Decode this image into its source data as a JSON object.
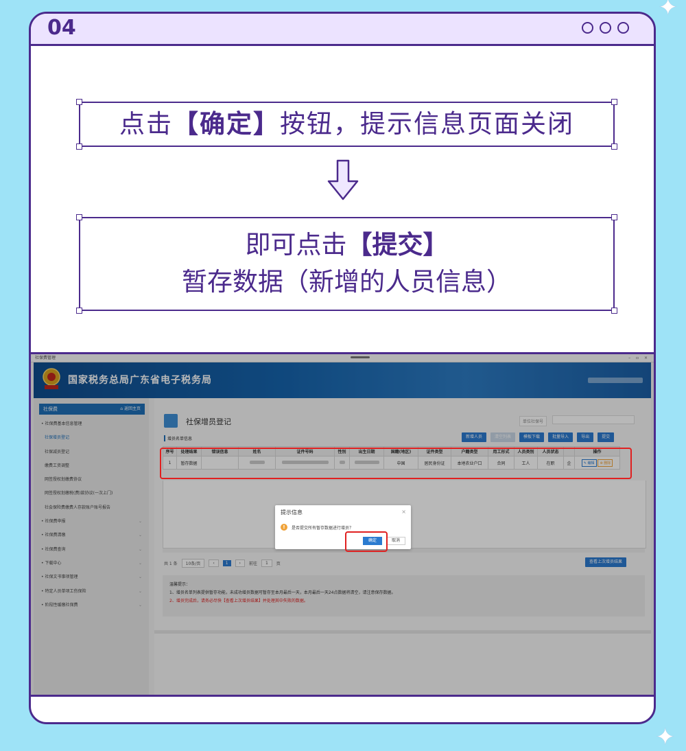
{
  "step": {
    "number": "04"
  },
  "instruction1": {
    "prefix": "点击",
    "highlight": "【确定】",
    "suffix": "按钮，提示信息页面关闭"
  },
  "instruction2": {
    "prefix": "即可点击",
    "highlight": "【提交】",
    "line2": "暂存数据（新增的人员信息）"
  },
  "icons": {
    "header_dots": "circle-icon",
    "arrow": "down-arrow-icon",
    "sparkle": "sparkle-icon",
    "emblem": "tax-emblem-icon",
    "warning": "warning-icon",
    "close": "close-icon"
  },
  "colors": {
    "accent": "#4b2a8c",
    "background": "#9ee3f7",
    "header": "#ece3ff",
    "brand_blue": "#1f6fb8",
    "highlight_red": "#e02020"
  },
  "screenshot": {
    "window_title": "社保费管理",
    "window_controls": "– ▫ ×",
    "brand_title": "国家税务总局广东省电子税务局",
    "sidebar": {
      "header": "社保费",
      "back": "⌂ 返回主页",
      "items": [
        {
          "label": "• 社保费基本信息管理"
        },
        {
          "label": "社保增员登记"
        },
        {
          "label": "社保减员登记"
        },
        {
          "label": "缴费工资调整"
        },
        {
          "label": "网签授权划缴费协议"
        },
        {
          "label": "网签授权划缴税(费)款协议(一次上门)"
        },
        {
          "label": "社会保险费缴费人存款账户账号报告"
        },
        {
          "label": "• 社保费申报"
        },
        {
          "label": "• 社保费清缴"
        },
        {
          "label": "• 社保费查询"
        },
        {
          "label": "• 下载中心"
        },
        {
          "label": "• 社保文书事项管理"
        },
        {
          "label": "• 特定人员单项工伤保险"
        },
        {
          "label": "• 阶段性缓缴社保费"
        }
      ]
    },
    "page_title": "社保增员登记",
    "unit_label": "单位社保号",
    "list_title": "增员名单信息",
    "toolbar": [
      "新增人员",
      "清空列表",
      "模板下载",
      "批量导入",
      "导出",
      "提交"
    ],
    "table": {
      "headers": [
        "序号",
        "处理结果",
        "错误信息",
        "姓名",
        "证件号码",
        "性别",
        "出生日期",
        "国籍(地区)",
        "证件类型",
        "户籍类型",
        "用工形式",
        "人员类别",
        "人员状态",
        "",
        "操作"
      ],
      "row": {
        "index": "1",
        "result": "暂存数据",
        "nationality": "中国",
        "id_type": "居民身份证",
        "household": "本地农业户口",
        "employment": "合同",
        "category": "工人",
        "status": "在职",
        "extra": "企",
        "edit": "✎ 编辑",
        "delete": "⊗ 删除"
      }
    },
    "pager": {
      "total": "共 1 条",
      "per_page": "10条/页",
      "prev": "‹",
      "page": "1",
      "next": "›",
      "goto": "前往",
      "goto_page": "1",
      "page_unit": "页"
    },
    "view_last": "查看上次增员结果",
    "tips": {
      "title": "温馨提示：",
      "line1": "1、增员名单列表提供暂存功能，未成功增员数据可暂存至本月最后一天，本月最后一天24点数据将清空，请注意保存数据。",
      "line2": "2、增员完成后，请务必尽快【查看上次增员结果】并处理其中失败的数据。"
    },
    "dialog": {
      "title": "提示信息",
      "close": "×",
      "icon": "!",
      "message": "是否提交所有暂存数据进行增员？",
      "ok": "确定",
      "cancel": "取消"
    }
  }
}
